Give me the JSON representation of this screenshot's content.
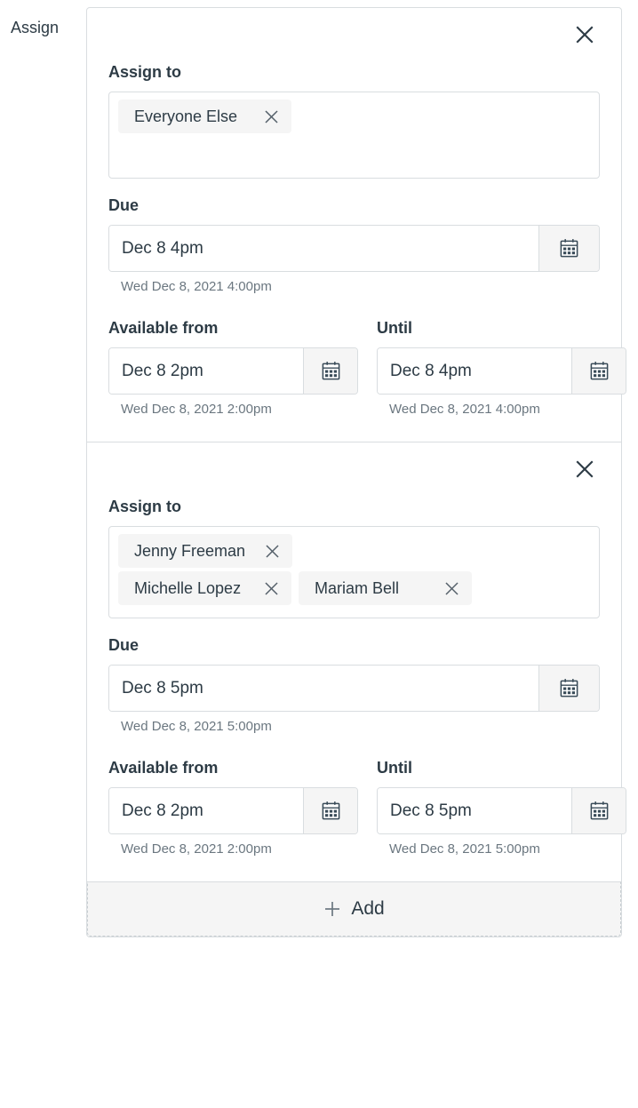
{
  "page": {
    "side_label": "Assign",
    "add_button_label": "Add",
    "add_icon": "plus-icon",
    "close_icon": "close-icon",
    "calendar_icon": "calendar-icon",
    "remove_pill_icon": "close-icon"
  },
  "colors": {
    "text": "#2d3b45",
    "helper_text": "#6b7780",
    "border": "#d9dde0",
    "pill_bg": "#f5f5f5",
    "footer_bg": "#f5f5f5",
    "card_bg": "#ffffff",
    "calendar_icon_frame": "#394b58"
  },
  "overrides": [
    {
      "assign_to_label": "Assign to",
      "pill_rows": [
        [
          {
            "name": "Everyone Else"
          }
        ]
      ],
      "due": {
        "label": "Due",
        "value": "Dec 8 4pm",
        "placeholder": "",
        "helper": "Wed Dec 8, 2021 4:00pm"
      },
      "available_from": {
        "label": "Available from",
        "value": "Dec 8 2pm",
        "placeholder": "",
        "helper": "Wed Dec 8, 2021 2:00pm"
      },
      "until": {
        "label": "Until",
        "value": "Dec 8 4pm",
        "placeholder": "",
        "helper": "Wed Dec 8, 2021 4:00pm"
      }
    },
    {
      "assign_to_label": "Assign to",
      "pill_rows": [
        [
          {
            "name": "Jenny Freeman"
          }
        ],
        [
          {
            "name": "Michelle Lopez"
          },
          {
            "name": "Mariam Bell"
          }
        ]
      ],
      "due": {
        "label": "Due",
        "value": "Dec 8 5pm",
        "placeholder": "",
        "helper": "Wed Dec 8, 2021 5:00pm"
      },
      "available_from": {
        "label": "Available from",
        "value": "Dec 8 2pm",
        "placeholder": "",
        "helper": "Wed Dec 8, 2021 2:00pm"
      },
      "until": {
        "label": "Until",
        "value": "Dec 8 5pm",
        "placeholder": "",
        "helper": "Wed Dec 8, 2021 5:00pm"
      }
    }
  ]
}
